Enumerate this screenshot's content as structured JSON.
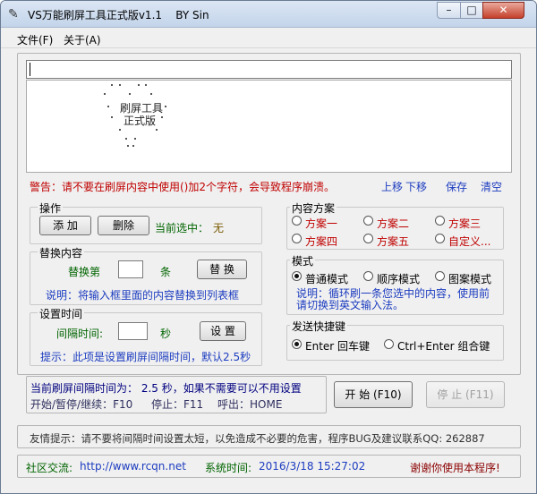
{
  "window": {
    "title": "VS万能刷屏工具正式版v1.1    BY Sin",
    "min_glyph": "–",
    "max_glyph": "□",
    "close_glyph": "✕"
  },
  "menu": {
    "file": "文件(F)",
    "about": "关于(A)"
  },
  "display": {
    "line1": "刷屏工具",
    "line2": "正式版"
  },
  "warning": "警告：请不要在刷屏内容中使用()加2个字符，会导致程序崩溃。",
  "links": {
    "up": "上移",
    "down": "下移",
    "save": "保存",
    "clear": "清空"
  },
  "ops": {
    "title": "操作",
    "add": "添 加",
    "delete": "删除",
    "current_label": "当前选中：",
    "current_value": "无"
  },
  "replace": {
    "title": "替换内容",
    "prefix": "替换第",
    "suffix": "条",
    "button": "替 换",
    "note": "说明：将输入框里面的内容替换到列表框"
  },
  "interval": {
    "title": "设置时间",
    "label": "间隔时间:",
    "unit": "秒",
    "button": "设 置",
    "hint": "提示：此项是设置刷屏间隔时间，默认2.5秒"
  },
  "plans": {
    "title": "内容方案",
    "items": [
      "方案一",
      "方案二",
      "方案三",
      "方案四",
      "方案五",
      "自定义..."
    ]
  },
  "mode": {
    "title": "模式",
    "options": [
      "普通模式",
      "顺序模式",
      "图案模式"
    ],
    "selected": 0,
    "desc": "说明：循环刷一条您选中的内容，使用前请切换到英文输入法。"
  },
  "hotkey": {
    "title": "发送快捷键",
    "options": [
      "Enter 回车键",
      "Ctrl+Enter 组合键"
    ],
    "selected": 0
  },
  "status": {
    "line1": "当前刷屏间隔时间为： 2.5 秒，如果不需要可以不用设置",
    "line2_a": "开始/暂停/继续：F10",
    "line2_b": "停止：F11",
    "line2_c": "呼出：HOME"
  },
  "start": "开 始 (F10)",
  "stop": "停 止 (F11)",
  "tip": "友情提示：请不要将间隔时间设置太短，以免造成不必要的危害，程序BUG及建议联系QQ: 262887",
  "footer": {
    "community_label": "社区交流:",
    "url": "http://www.rcqn.net",
    "time_label": "系统时间:",
    "time_value": "2016/3/18 15:27:02",
    "thanks": "谢谢你使用本程序!"
  },
  "colors": {
    "accent_blue": "#1c3cc0",
    "warn_red": "#c00000",
    "label_green": "#006400"
  }
}
